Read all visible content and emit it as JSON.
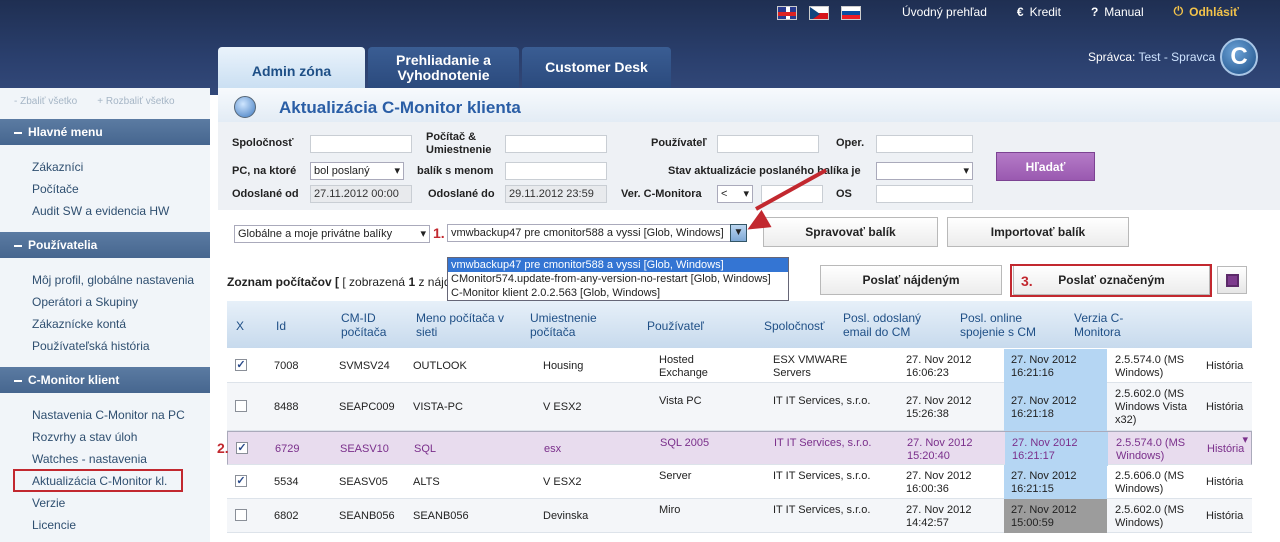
{
  "topbar": {
    "menu": [
      {
        "icon": "home-icon",
        "label": "Úvodný prehľad"
      },
      {
        "icon": "euro-icon",
        "glyph": "€",
        "label": "Kredit"
      },
      {
        "icon": "help-icon",
        "glyph": "?",
        "label": "Manual"
      },
      {
        "icon": "power-icon",
        "glyph": "⏻",
        "label": "Odhlásiť"
      }
    ],
    "tabs": [
      "Admin zóna",
      "Prehliadanie a Vyhodnotenie",
      "Customer Desk"
    ],
    "admin_label": "Správca:",
    "admin_name": "Test - Spravca",
    "logo_glyph": "C"
  },
  "sidebar": {
    "collapse_all": "Zbaliť všetko",
    "expand_all": "Rozbaliť všetko",
    "sections": [
      {
        "title": "Hlavné menu",
        "items": [
          "Zákazníci",
          "Počítače",
          "Audit SW a evidencia HW"
        ]
      },
      {
        "title": "Používatelia",
        "items": [
          "Môj profil, globálne nastavenia",
          "Operátori a Skupiny",
          "Zákaznícke kontá",
          "Používateľská história"
        ]
      },
      {
        "title": "C-Monitor klient",
        "items": [
          "Nastavenia C-Monitor na PC",
          "Rozvrhy a stav úloh",
          "Watches - nastavenia",
          "Aktualizácia C-Monitor kl.",
          "Verzie",
          "Licencie"
        ]
      }
    ]
  },
  "page": {
    "title": "Aktualizácia C-Monitor klienta"
  },
  "filters": {
    "company_label": "Spoločnosť",
    "computer_label": "Počítač & Umiestnenie",
    "user_label": "Používateľ",
    "oper_label": "Oper.",
    "pc_label": "PC, na ktoré",
    "pc_value": "bol poslaný",
    "package_name_label": "balík s menom",
    "status_label": "Stav aktualizácie poslaného balíka je",
    "sent_from_label": "Odoslané od",
    "sent_from_value": "27.11.2012 00:00",
    "sent_to_label": "Odoslané do",
    "sent_to_value": "29.11.2012 23:59",
    "version_label": "Ver. C-Monitora",
    "version_op": "<",
    "os_label": "OS",
    "search_button": "Hľadať"
  },
  "package": {
    "scope_value": "Globálne a moje privátne balíky",
    "marker1": "1.",
    "selected_package": "vmwbackup47 pre cmonitor588 a vyssi [Glob, Windows]",
    "options": [
      "vmwbackup47 pre cmonitor588 a vyssi [Glob, Windows]",
      "CMonitor574.update-from-any-version-no-restart [Glob, Windows]",
      "C-Monitor klient 2.0.2.563 [Glob, Windows]"
    ],
    "manage_button": "Spravovať balík",
    "import_button": "Importovať balík"
  },
  "list": {
    "title": "Zoznam počítačov",
    "shown": "[ zobrazená",
    "count": "1",
    "rest": "z nájde",
    "send_found_button": "Poslať nájdeným",
    "marker3": "3.",
    "send_marked_button": "Poslať označeným",
    "marker2": "2."
  },
  "table": {
    "headers": [
      "X",
      "Id",
      "CM-ID počítača",
      "Meno počítača v sieti",
      "Umiestnenie počítača",
      "Používateľ",
      "Spoločnosť",
      "Posl. odoslaný email do CM",
      "Posl. online spojenie s CM",
      "Verzia C-Monitora"
    ],
    "rows": [
      {
        "checked": true,
        "id": "7008",
        "cmid": "SVMSV24",
        "name": "OUTLOOK",
        "location": "Housing",
        "user": "Hosted Exchange",
        "company": "ESX VMWARE Servers",
        "email": "27. Nov 2012 16:06:23",
        "online": "27. Nov 2012 16:21:16",
        "version": "2.5.574.0 (MS Windows)",
        "history": "História"
      },
      {
        "checked": false,
        "id": "8488",
        "cmid": "SEAPC009",
        "name": "VISTA-PC",
        "location": "V ESX2",
        "user": "Vista PC",
        "company": "IT IT Services, s.r.o.",
        "email": "27. Nov 2012 15:26:38",
        "online": "27. Nov 2012 16:21:18",
        "version": "2.5.602.0 (MS Windows Vista x32)",
        "history": "História"
      },
      {
        "checked": true,
        "id": "6729",
        "cmid": "SEASV10",
        "name": "SQL",
        "location": "esx",
        "user": "SQL 2005",
        "company": "IT IT Services, s.r.o.",
        "email": "27. Nov 2012 15:20:40",
        "online": "27. Nov 2012 16:21:17",
        "version": "2.5.574.0 (MS Windows)",
        "history": "História"
      },
      {
        "checked": true,
        "id": "5534",
        "cmid": "SEASV05",
        "name": "ALTS",
        "location": "V ESX2",
        "user": "Server",
        "company": "IT IT Services, s.r.o.",
        "email": "27. Nov 2012 16:00:36",
        "online": "27. Nov 2012 16:21:15",
        "version": "2.5.606.0 (MS Windows)",
        "history": "História"
      },
      {
        "checked": false,
        "id": "6802",
        "cmid": "SEANB056",
        "name": "SEANB056",
        "location": "Devinska",
        "user": "Miro",
        "company": "IT IT Services, s.r.o.",
        "email": "27. Nov 2012 14:42:57",
        "online": "27. Nov 2012 15:00:59",
        "version": "2.5.602.0 (MS Windows)",
        "history": "História"
      }
    ]
  }
}
